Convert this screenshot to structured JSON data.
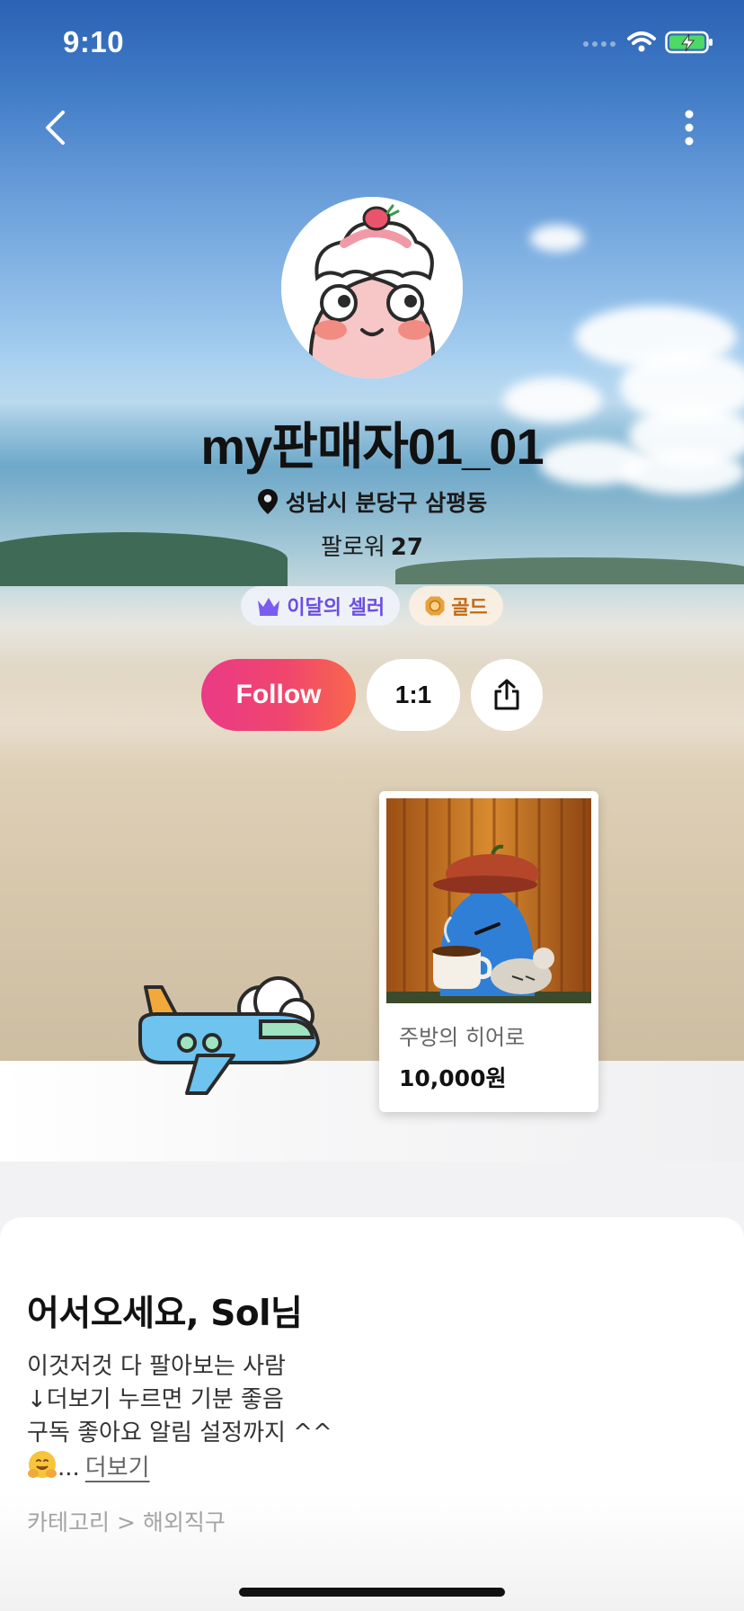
{
  "status_bar": {
    "time": "9:10"
  },
  "nav": {
    "back_icon": "chevron-left-icon",
    "more_icon": "vertical-ellipsis-icon"
  },
  "profile": {
    "name": "my판매자01_01",
    "location": "성남시 분당구 삼평동",
    "follower_label": "팔로워",
    "follower_count": "27",
    "badges": [
      {
        "label": "이달의 셀러",
        "icon": "crown-icon",
        "color": "#6c4ee0"
      },
      {
        "label": "골드",
        "icon": "gold-medal-icon",
        "color": "#c06a16"
      }
    ]
  },
  "actions": {
    "follow_label": "Follow",
    "chat_label": "1:1",
    "share_icon": "share-icon"
  },
  "product": {
    "title": "주방의 히어로",
    "price": "10,000원"
  },
  "about": {
    "greeting": "어서오세요, Sol님",
    "intro_lines": [
      "이것저것 다 팔아보는 사람",
      "↓더보기 누르면 기분 좋음",
      "구독 좋아요 알림 설정까지 ^^"
    ],
    "ellipsis": "...",
    "more_label": "더보기",
    "category": "카테고리 > 해외직구"
  },
  "colors": {
    "follow_gradient_start": "#ea3a86",
    "follow_gradient_end": "#f8674c",
    "seller_badge": "#6c4ee0",
    "gold_badge": "#c06a16"
  }
}
